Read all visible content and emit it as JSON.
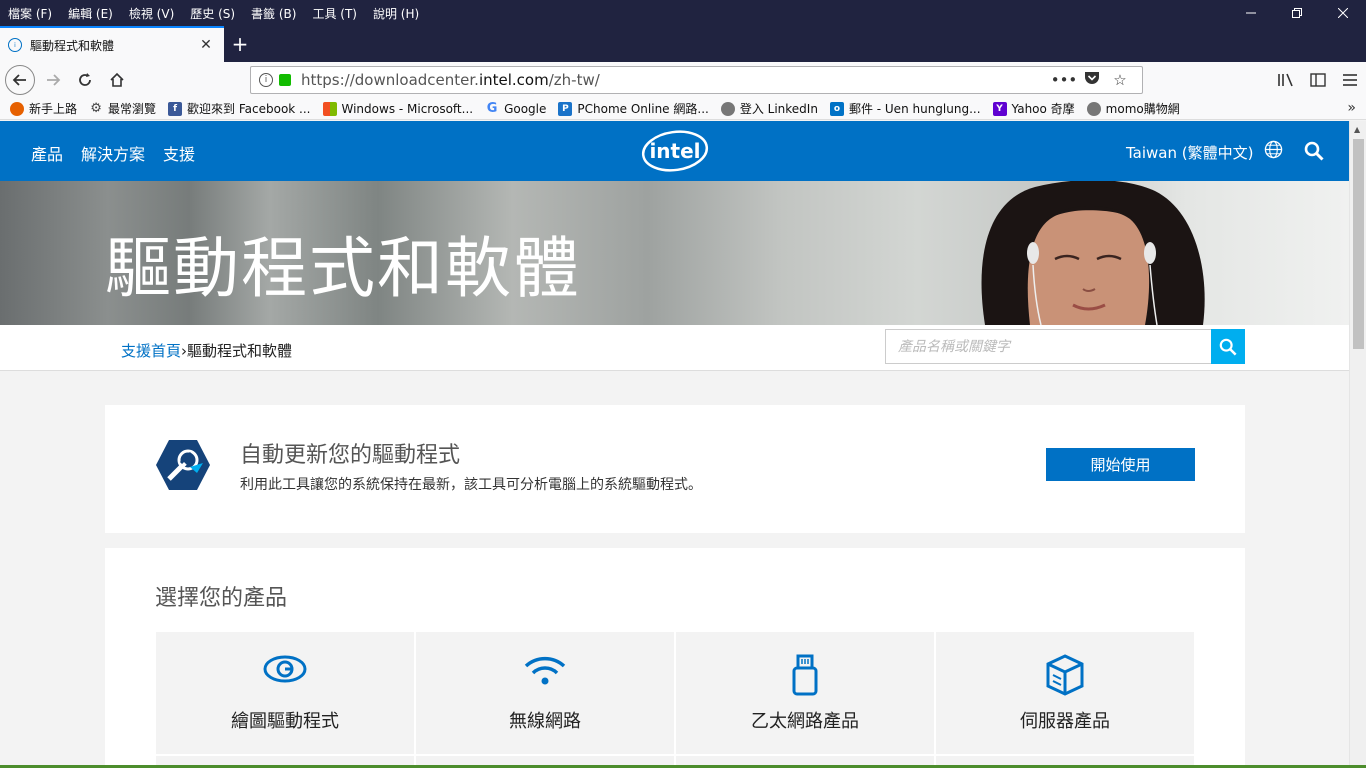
{
  "menubar": {
    "items": [
      "檔案 (F)",
      "編輯 (E)",
      "檢視 (V)",
      "歷史 (S)",
      "書籤 (B)",
      "工具 (T)",
      "說明 (H)"
    ]
  },
  "tab": {
    "title": "驅動程式和軟體",
    "close": "✕",
    "newtab": "+"
  },
  "navbar": {
    "url_prefix": "https://downloadcenter.",
    "url_domain": "intel.com",
    "url_suffix": "/zh-tw/"
  },
  "bookmarks": [
    {
      "label": "新手上路",
      "icon": "firefox-icon",
      "color": "#e66000"
    },
    {
      "label": "最常瀏覽",
      "icon": "gear-icon",
      "color": "#555555"
    },
    {
      "label": "歡迎來到 Facebook ...",
      "icon": "facebook-icon",
      "color": "#3b5998"
    },
    {
      "label": "Windows - Microsoft...",
      "icon": "windows-icon",
      "color": "#f25022"
    },
    {
      "label": "Google",
      "icon": "google-icon",
      "color": "#4285f4"
    },
    {
      "label": "PChome Online 網路...",
      "icon": "pchome-icon",
      "color": "#1a73c9"
    },
    {
      "label": "登入 LinkedIn",
      "icon": "globe-icon",
      "color": "#666666"
    },
    {
      "label": "郵件 - Uen hunglung...",
      "icon": "outlook-icon",
      "color": "#0072c6"
    },
    {
      "label": "Yahoo 奇摩",
      "icon": "yahoo-icon",
      "color": "#5f01d1"
    },
    {
      "label": "momo購物網",
      "icon": "globe-icon",
      "color": "#666666"
    }
  ],
  "site": {
    "nav": [
      "產品",
      "解決方案",
      "支援"
    ],
    "logo_text": "intel",
    "region": "Taiwan (繁體中文)"
  },
  "hero": {
    "title": "驅動程式和軟體"
  },
  "breadcrumb": {
    "home": "支援首頁",
    "separator": "›",
    "current": "驅動程式和軟體"
  },
  "search": {
    "placeholder": "產品名稱或關鍵字"
  },
  "update_card": {
    "title": "自動更新您的驅動程式",
    "description": "利用此工具讓您的系統保持在最新，該工具可分析電腦上的系統驅動程式。",
    "button": "開始使用"
  },
  "products": {
    "heading": "選擇您的產品",
    "items": [
      {
        "label": "繪圖驅動程式",
        "icon": "graphics-eye-icon"
      },
      {
        "label": "無線網路",
        "icon": "wifi-icon"
      },
      {
        "label": "乙太網路產品",
        "icon": "ethernet-plug-icon"
      },
      {
        "label": "伺服器產品",
        "icon": "server-cube-icon"
      }
    ]
  },
  "colors": {
    "intel_blue": "#0071c5",
    "search_blue": "#00aeef",
    "chrome_dark": "#202340"
  }
}
